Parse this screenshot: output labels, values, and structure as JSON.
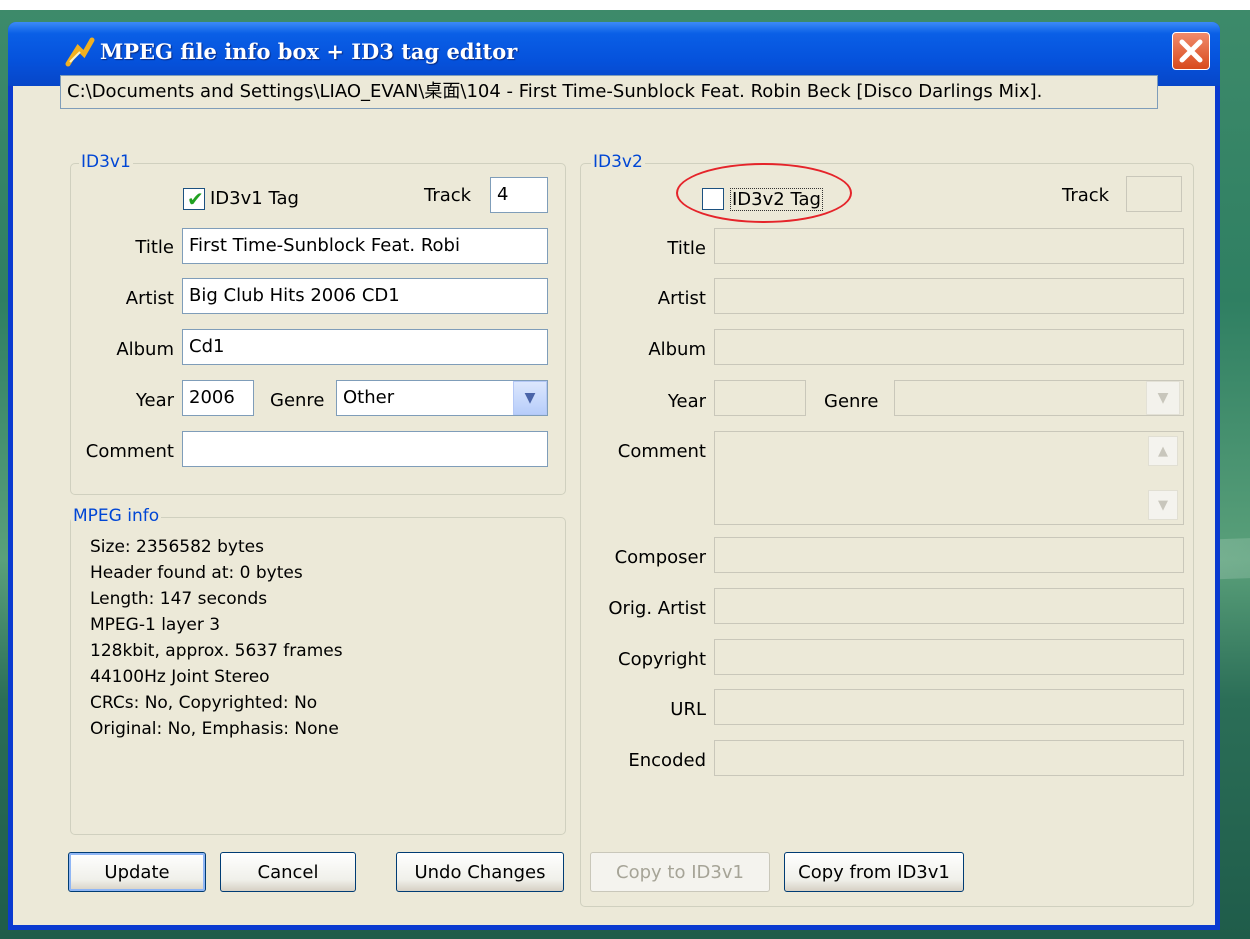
{
  "window": {
    "title": "MPEG file info box + ID3 tag editor",
    "close_glyph": "✕"
  },
  "file_path": "C:\\Documents and Settings\\LIAO_EVAN\\桌面\\104 - First Time-Sunblock Feat. Robin Beck [Disco Darlings Mix].",
  "id3v1": {
    "group_label": "ID3v1",
    "tag_checkbox_label": "ID3v1 Tag",
    "tag_checked": true,
    "track_label": "Track",
    "track_value": "4",
    "title_label": "Title",
    "title_value": "First Time-Sunblock Feat. Robi",
    "artist_label": "Artist",
    "artist_value": "Big Club Hits 2006 CD1",
    "album_label": "Album",
    "album_value": "Cd1",
    "year_label": "Year",
    "year_value": "2006",
    "genre_label": "Genre",
    "genre_value": "Other",
    "comment_label": "Comment",
    "comment_value": ""
  },
  "mpeg_info": {
    "group_label": "MPEG info",
    "lines": [
      "Size: 2356582 bytes",
      "Header found at: 0 bytes",
      "Length: 147 seconds",
      "MPEG-1 layer 3",
      "128kbit, approx. 5637 frames",
      "44100Hz Joint Stereo",
      "CRCs: No, Copyrighted: No",
      "Original: No, Emphasis: None"
    ]
  },
  "id3v2": {
    "group_label": "ID3v2",
    "tag_checkbox_label": "ID3v2 Tag",
    "tag_checked": false,
    "track_label": "Track",
    "title_label": "Title",
    "artist_label": "Artist",
    "album_label": "Album",
    "year_label": "Year",
    "genre_label": "Genre",
    "comment_label": "Comment",
    "composer_label": "Composer",
    "orig_artist_label": "Orig. Artist",
    "copyright_label": "Copyright",
    "url_label": "URL",
    "encoded_label": "Encoded"
  },
  "buttons": {
    "update": "Update",
    "cancel": "Cancel",
    "undo": "Undo Changes",
    "copy_to": "Copy to ID3v1",
    "copy_from": "Copy from ID3v1"
  },
  "colors": {
    "titlebar": "#0552dc",
    "client_bg": "#ece9d8",
    "group_label": "#0046d5",
    "highlight_ellipse": "#e5242a"
  }
}
